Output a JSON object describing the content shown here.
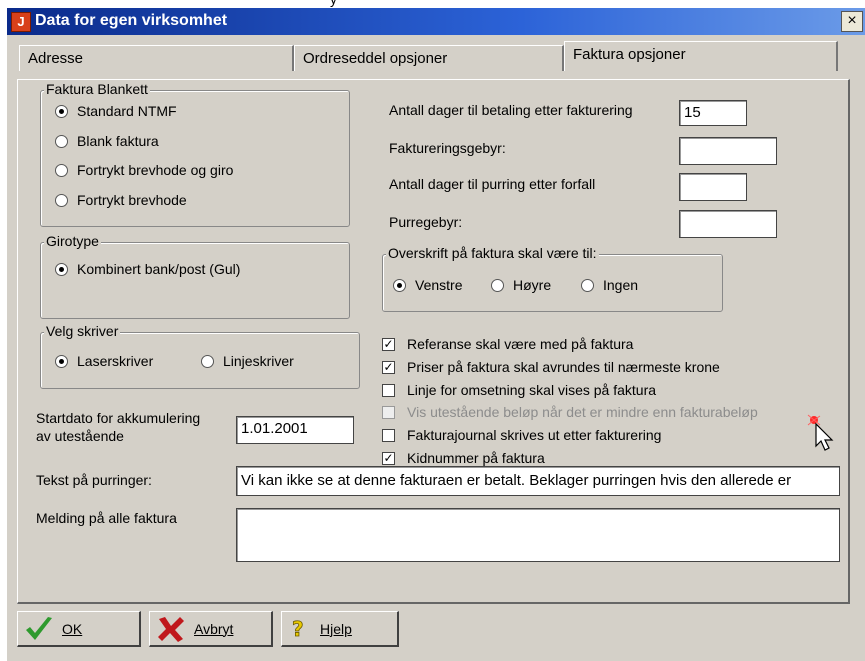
{
  "top_fragment": "y",
  "window": {
    "title": "Data for egen virksomhet",
    "close_label": "×"
  },
  "tabs": [
    {
      "label": "Adresse",
      "active": false
    },
    {
      "label": "Ordreseddel opsjoner",
      "active": false
    },
    {
      "label": "Faktura opsjoner",
      "active": true
    }
  ],
  "faktura_blankett": {
    "label": "Faktura Blankett",
    "options": [
      {
        "label": "Standard NTMF",
        "selected": true
      },
      {
        "label": "Blank faktura",
        "selected": false
      },
      {
        "label": "Fortrykt brevhode og giro",
        "selected": false
      },
      {
        "label": "Fortrykt brevhode",
        "selected": false
      }
    ]
  },
  "girotype": {
    "label": "Girotype",
    "options": [
      {
        "label": "Kombinert bank/post (Gul)",
        "selected": true
      }
    ]
  },
  "skriver": {
    "label": "Velg skriver",
    "options": [
      {
        "label": "Laserskriver",
        "selected": true
      },
      {
        "label": "Linjeskriver",
        "selected": false
      }
    ]
  },
  "right_fields": [
    {
      "label": "Antall dager til betaling etter fakturering",
      "value": "15"
    },
    {
      "label": "Faktureringsgebyr:",
      "value": ""
    },
    {
      "label": "Antall dager til purring etter forfall",
      "value": ""
    },
    {
      "label": "Purregebyr:",
      "value": ""
    }
  ],
  "overskrift": {
    "label": "Overskrift på faktura skal være til:",
    "options": [
      {
        "label": "Venstre",
        "selected": true
      },
      {
        "label": "Høyre",
        "selected": false
      },
      {
        "label": "Ingen",
        "selected": false
      }
    ]
  },
  "checkboxes": [
    {
      "label": "Referanse skal være med på faktura",
      "checked": true,
      "enabled": true
    },
    {
      "label": "Priser på faktura skal avrundes til nærmeste krone",
      "checked": true,
      "enabled": true
    },
    {
      "label": "Linje for omsetning skal vises på faktura",
      "checked": false,
      "enabled": true
    },
    {
      "label": "Vis utestående beløp når det er mindre enn fakturabeløp",
      "checked": false,
      "enabled": false
    },
    {
      "label": "Fakturajournal skrives ut etter fakturering",
      "checked": false,
      "enabled": true
    },
    {
      "label": "Kidnummer på faktura",
      "checked": true,
      "enabled": true
    }
  ],
  "startdato": {
    "label_line1": "Startdato for akkumulering",
    "label_line2": "av utestående",
    "value": "1.01.2001"
  },
  "purring_tekst": {
    "label": "Tekst på purringer:",
    "value": "Vi kan ikke se at denne fakturaen er betalt. Beklager purringen hvis den allerede er"
  },
  "melding": {
    "label": "Melding på alle faktura",
    "value": ""
  },
  "buttons": {
    "ok": "OK",
    "avbryt": "Avbryt",
    "hjelp": "Hjelp"
  },
  "colors": {
    "titlebar": "#2c63d8",
    "dialog_bg": "#d4d0c8",
    "ok_icon": "#2e9a2e",
    "cancel_icon": "#c0181c",
    "help_icon": "#e8c800"
  },
  "icons": {
    "app": "app-icon",
    "ok": "checkmark-icon",
    "cancel": "x-icon",
    "help": "help-icon",
    "cursor": "mouse-cursor-icon"
  }
}
